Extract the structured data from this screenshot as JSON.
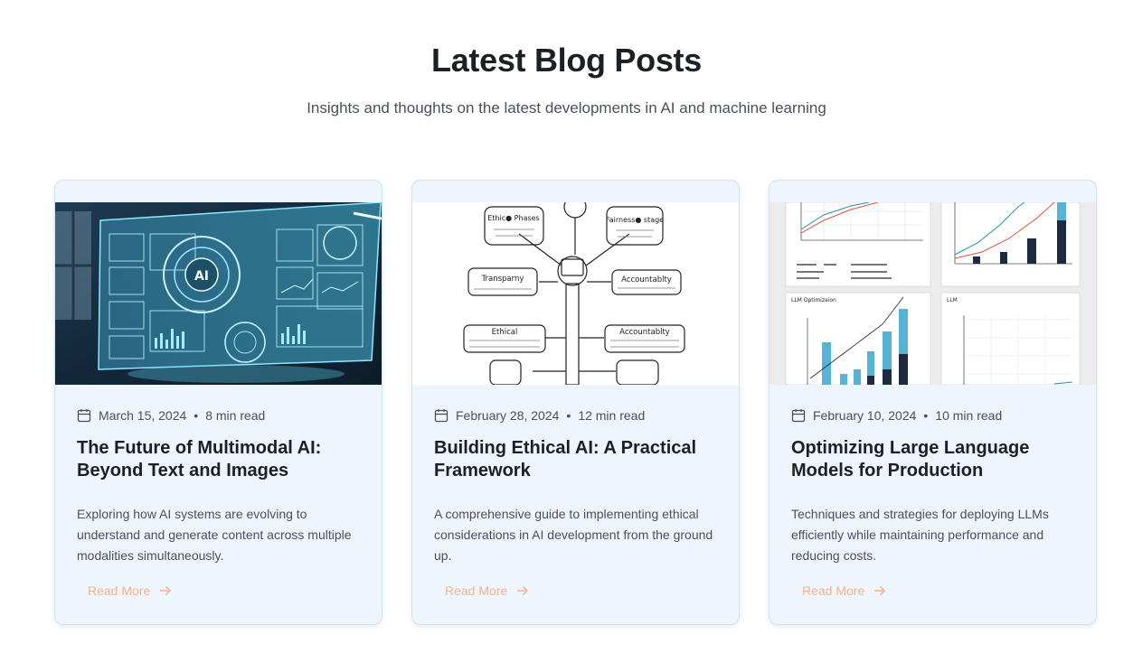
{
  "header": {
    "title": "Latest Blog Posts",
    "subtitle": "Insights and thoughts on the latest developments in AI and machine learning"
  },
  "posts": [
    {
      "date": "March 15, 2024",
      "read_time": "8 min read",
      "title": "The Future of Multimodal AI: Beyond Text and Images",
      "excerpt": "Exploring how AI systems are evolving to understand and generate content across multiple modalities simultaneously.",
      "read_more": "Read More",
      "image_icon": "ai-dashboard-illustration"
    },
    {
      "date": "February 28, 2024",
      "read_time": "12 min read",
      "title": "Building Ethical AI: A Practical Framework",
      "excerpt": "A comprehensive guide to implementing ethical considerations in AI development from the ground up.",
      "read_more": "Read More",
      "image_icon": "ethics-framework-diagram",
      "diagram": {
        "top_left": "Ethic● Phases",
        "top_right": "Fairness● stage",
        "mid_left": "Transparny",
        "mid_right": "Accountablty",
        "low_left": "Ethical",
        "low_right": "Accountablty"
      }
    },
    {
      "date": "February 10, 2024",
      "read_time": "10 min read",
      "title": "Optimizing Large Language Models for Production",
      "excerpt": "Techniques and strategies for deploying LLMs efficiently while maintaining performance and reducing costs.",
      "read_more": "Read More",
      "image_icon": "performance-charts-illustration",
      "charts": {
        "panel_3_title": "LLM Optimizaion",
        "panel_4_title": "LLM"
      }
    }
  ],
  "colors": {
    "card_bg": "#eef5fc",
    "accent_link": "#f6b28c",
    "title": "#1c1f23",
    "muted": "#4b5058"
  }
}
